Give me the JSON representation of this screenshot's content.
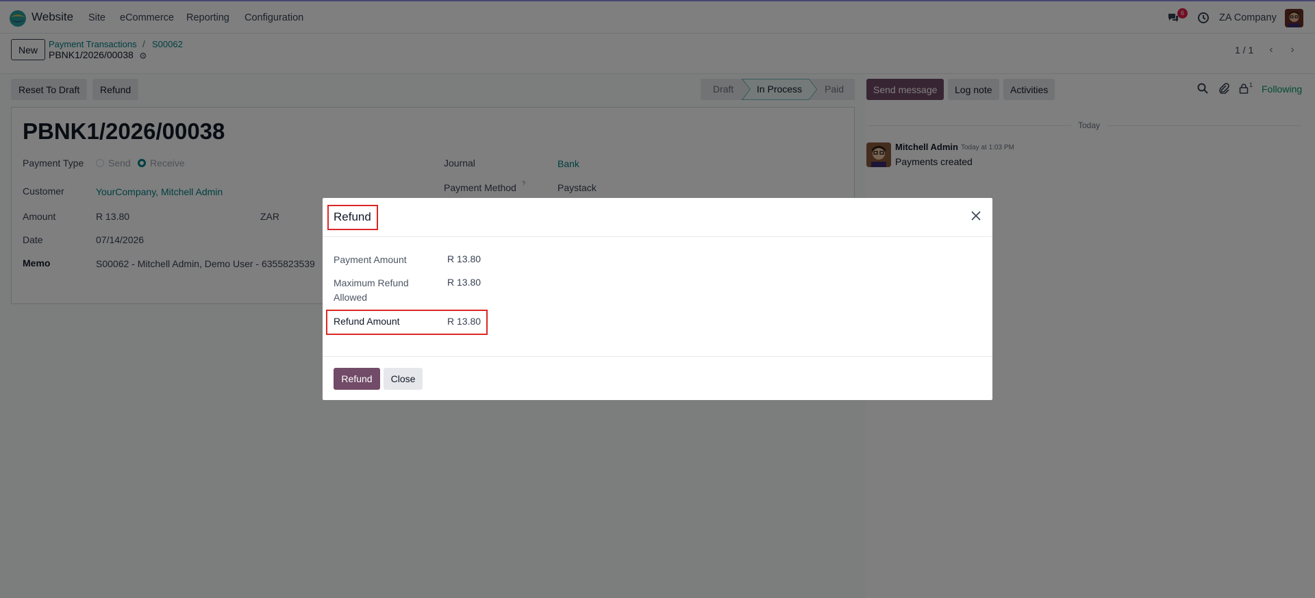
{
  "navbar": {
    "app_name": "Website",
    "menu": [
      "Site",
      "eCommerce",
      "Reporting",
      "Configuration"
    ],
    "messages_badge": "6",
    "company": "ZA Company"
  },
  "control_panel": {
    "new_label": "New",
    "breadcrumbs": [
      "Payment Transactions",
      "S00062"
    ],
    "record_name": "PBNK1/2026/00038",
    "pager": "1 / 1"
  },
  "statusbar": {
    "buttons": [
      "Reset To Draft",
      "Refund"
    ],
    "stages": [
      "Draft",
      "In Process",
      "Paid"
    ],
    "active_stage": "In Process"
  },
  "form": {
    "title": "PBNK1/2026/00038",
    "payment_type_label": "Payment Type",
    "payment_type_options": [
      "Send",
      "Receive"
    ],
    "customer_label": "Customer",
    "customer_value": "YourCompany, Mitchell Admin",
    "amount_label": "Amount",
    "amount_value": "R 13.80",
    "currency": "ZAR",
    "date_label": "Date",
    "date_value": "07/14/2026",
    "memo_label": "Memo",
    "memo_value": "S00062 - Mitchell Admin, Demo User - 6355823539",
    "journal_label": "Journal",
    "journal_value": "Bank",
    "payment_method_label": "Payment Method",
    "payment_method_help": "?",
    "payment_method_value": "Paystack"
  },
  "chatter": {
    "send_message": "Send message",
    "log_note": "Log note",
    "activities": "Activities",
    "followers_count": "1",
    "following": "Following",
    "today": "Today",
    "author": "Mitchell Admin",
    "time": "Today at 1:03 PM",
    "body": "Payments created"
  },
  "dialog": {
    "title": "Refund",
    "payment_amount_label": "Payment Amount",
    "payment_amount_value": "R 13.80",
    "max_refund_label_line1": "Maximum Refund",
    "max_refund_label_line2": "Allowed",
    "max_refund_value": "R 13.80",
    "refund_amount_label": "Refund Amount",
    "refund_amount_value": "R 13.80",
    "refund_button": "Refund",
    "close_button": "Close"
  },
  "colors": {
    "brand": "#714b67",
    "link": "#017e84",
    "highlight": "#dc2626",
    "following": "#059669"
  }
}
